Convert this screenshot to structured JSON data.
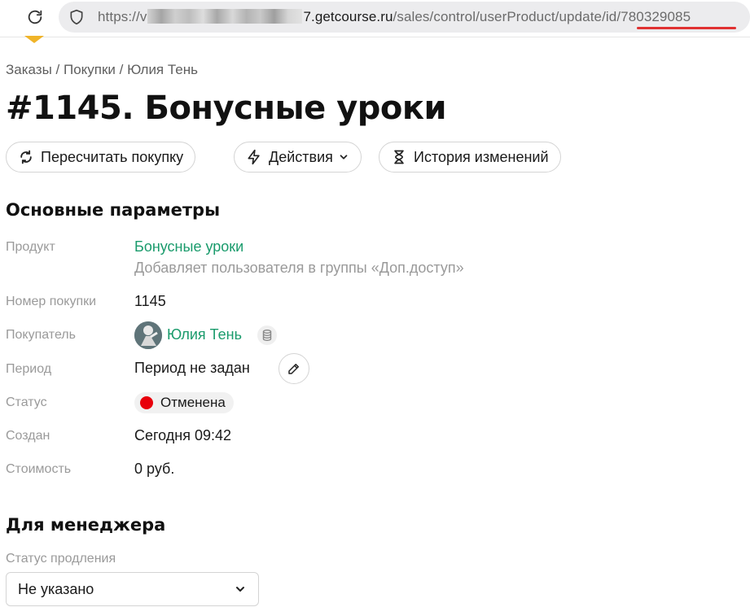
{
  "browser": {
    "url_prefix": "https://v",
    "url_host_suffix": "7.getcourse.ru",
    "url_path_start": "/sales/control/userProduct/update/",
    "url_path_highlight": "id/780329085",
    "accent_underline_color": "#e03131"
  },
  "breadcrumb": {
    "items": [
      "Заказы",
      "Покупки",
      "Юлия Тень"
    ],
    "separator": " / "
  },
  "page_title": "#1145. Бонусные уроки",
  "toolbar": {
    "recalc_label": "Пересчитать покупку",
    "actions_label": "Действия",
    "history_label": "История изменений"
  },
  "main_params": {
    "title": "Основные параметры",
    "product_label": "Продукт",
    "product_name": "Бонусные уроки",
    "product_desc": "Добавляет пользователя в группы «Доп.доступ»",
    "number_label": "Номер покупки",
    "number_value": "1145",
    "buyer_label": "Покупатель",
    "buyer_name": "Юлия Тень",
    "period_label": "Период",
    "period_value": "Период не задан",
    "status_label": "Статус",
    "status_value": "Отменена",
    "status_color": "#e8000b",
    "created_label": "Создан",
    "created_value": "Сегодня 09:42",
    "cost_label": "Стоимость",
    "cost_value": "0 руб."
  },
  "manager": {
    "title": "Для менеджера",
    "renewal_label": "Статус продления",
    "renewal_value": "Не указано"
  },
  "colors": {
    "link": "#1a9b6c",
    "muted": "#9a9a9a"
  }
}
